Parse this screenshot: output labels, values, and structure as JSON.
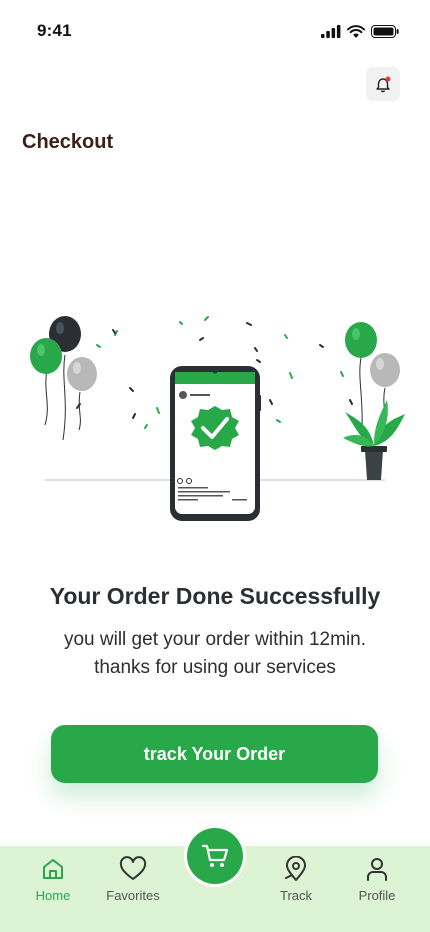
{
  "status": {
    "time": "9:41"
  },
  "header": {
    "title": "Checkout"
  },
  "main": {
    "title": "Your Order Done Successfully",
    "message_line1": "you will get your order within 12min.",
    "message_line2": "thanks for using our services",
    "cta_label": "track Your Order"
  },
  "nav": {
    "items": [
      {
        "label": "Home",
        "icon": "home-icon",
        "active": true
      },
      {
        "label": "Favorites",
        "icon": "heart-icon",
        "active": false
      },
      {
        "label": "Track",
        "icon": "map-pin-icon",
        "active": false
      },
      {
        "label": "Profile",
        "icon": "user-icon",
        "active": false
      }
    ],
    "center_icon": "cart-icon"
  },
  "colors": {
    "accent": "#29a84a",
    "nav_bg": "#dcf3d4",
    "title_text": "#3a1f1b",
    "body_text": "#2b2f33",
    "notification_dot": "#e53935"
  }
}
